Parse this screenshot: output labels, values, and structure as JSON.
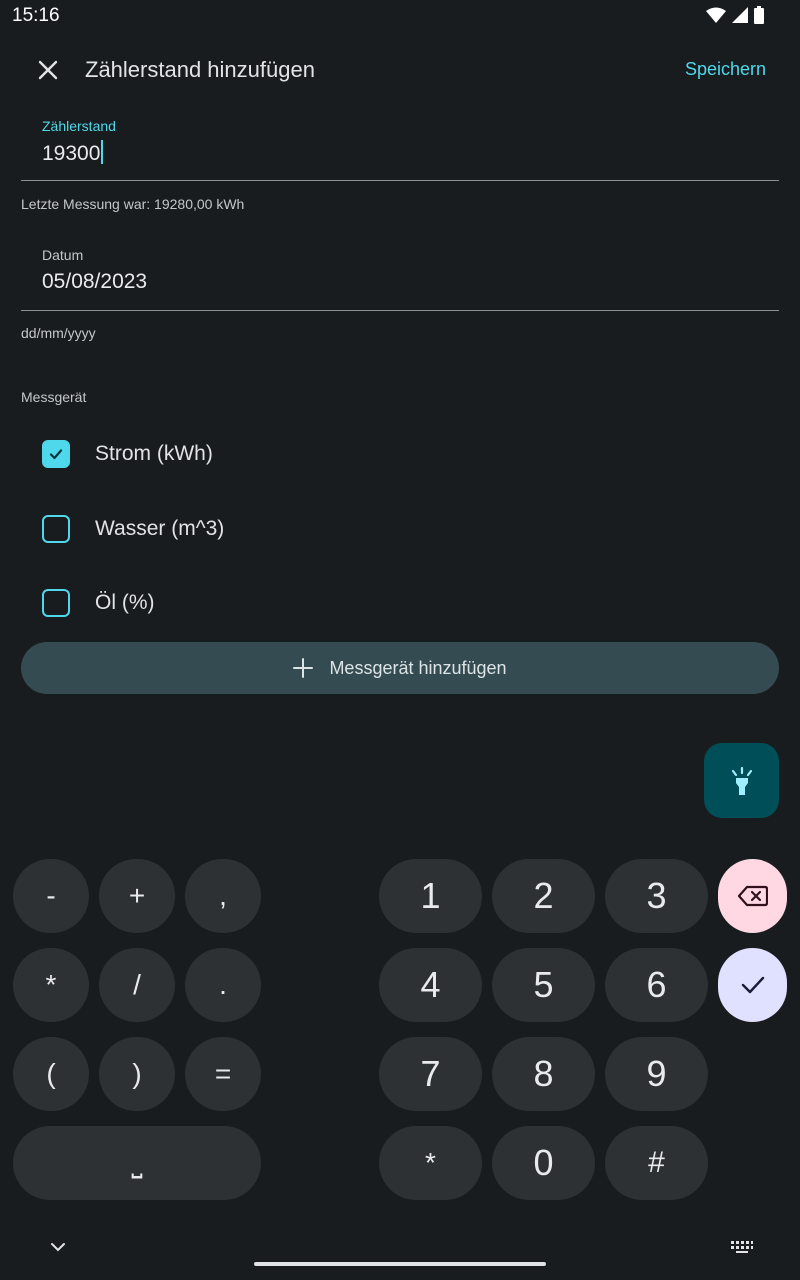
{
  "status_bar": {
    "time": "15:16"
  },
  "app_bar": {
    "title": "Zählerstand hinzufügen",
    "save_label": "Speichern"
  },
  "reading_field": {
    "label": "Zählerstand",
    "value": "19300",
    "helper": "Letzte Messung war: 19280,00 kWh"
  },
  "date_field": {
    "label": "Datum",
    "value": "05/08/2023",
    "helper": "dd/mm/yyyy"
  },
  "device_section": {
    "label": "Messgerät",
    "devices": [
      {
        "label": "Strom (kWh)",
        "checked": true
      },
      {
        "label": "Wasser (m^3)",
        "checked": false
      },
      {
        "label": "Öl (%)",
        "checked": false
      }
    ],
    "add_button_label": "Messgerät hinzufügen"
  },
  "fab": {
    "icon": "flashlight-icon"
  },
  "keyboard": {
    "symbol_keys": [
      "-",
      "+",
      ",",
      "*",
      "/",
      ".",
      "(",
      ")",
      "="
    ],
    "number_keys": [
      "1",
      "2",
      "3",
      "4",
      "5",
      "6",
      "7",
      "8",
      "9",
      "*",
      "0",
      "#"
    ],
    "space_key": "⎵",
    "backspace_icon": "backspace-icon",
    "enter_icon": "check-icon"
  },
  "colors": {
    "accent": "#4fd8eb",
    "background": "#191c1e",
    "key": "#2e3134",
    "backspace_key": "#ffd8e4",
    "enter_key": "#e0e0ff",
    "fab": "#004f58",
    "add_button": "#334b51"
  }
}
